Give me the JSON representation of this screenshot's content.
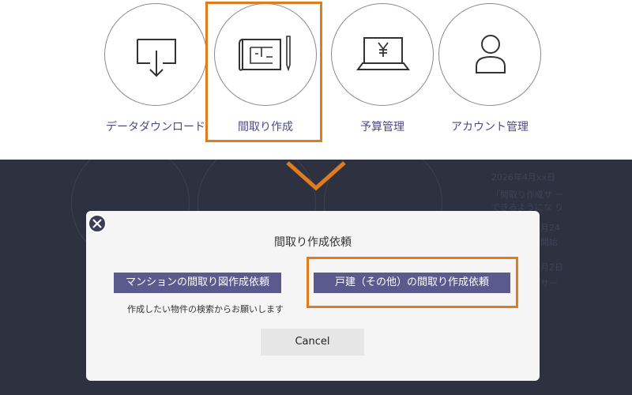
{
  "menu": {
    "items": [
      {
        "label": "データダウンロード",
        "icon": "download-icon"
      },
      {
        "label": "間取り作成",
        "icon": "floorplan-icon"
      },
      {
        "label": "予算管理",
        "icon": "budget-laptop-icon"
      },
      {
        "label": "アカウント管理",
        "icon": "user-icon"
      }
    ],
    "highlight_color": "#e07b1e"
  },
  "background": {
    "news": [
      {
        "text": "2026年4月xx日"
      },
      {
        "text": "「間取り作成サ ー"
      },
      {
        "text": "できるようにな り"
      },
      {
        "text": "月24"
      },
      {
        "text": "開始"
      },
      {
        "text": "月2日"
      },
      {
        "text": "サー"
      }
    ]
  },
  "dialog": {
    "title": "間取り作成依頼",
    "buttons": {
      "mansion": "マンションの間取り図作成依頼",
      "house": "戸建（その他）の間取り作成依頼"
    },
    "note": "作成したい物件の検索からお願いします",
    "cancel": "Cancel",
    "close_icon": "close-icon"
  },
  "colors": {
    "overlay": "#2e3140",
    "button": "#5a5a8c",
    "label": "#4a4a8a"
  }
}
